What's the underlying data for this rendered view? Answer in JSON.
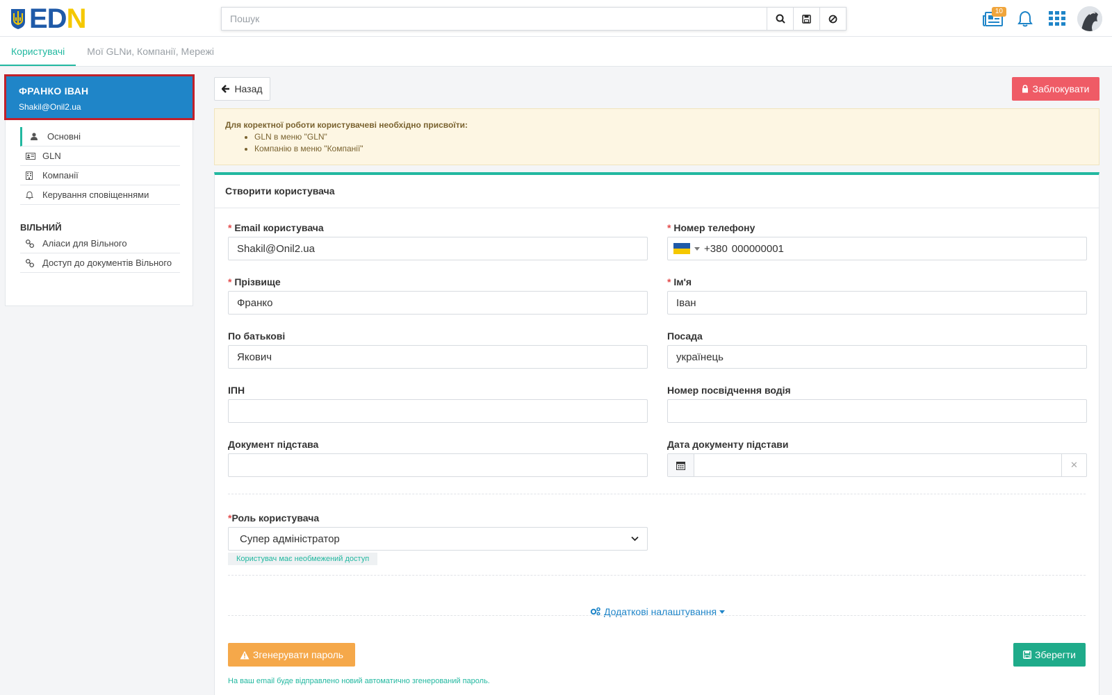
{
  "search": {
    "placeholder": "Пошук"
  },
  "header": {
    "notifications_badge": "10"
  },
  "tabs": [
    {
      "label": "Користувачі",
      "active": true
    },
    {
      "label": "Мої GLNи, Компанії, Мережі",
      "active": false
    }
  ],
  "user_card": {
    "name": "ФРАНКО ІВАН",
    "email": "Shakil@Onil2.ua"
  },
  "sidebar": {
    "items": [
      {
        "label": "Основні",
        "icon": "user-icon",
        "active": true
      },
      {
        "label": "GLN",
        "icon": "id-card-icon"
      },
      {
        "label": "Компанії",
        "icon": "building-icon"
      },
      {
        "label": "Керування сповіщеннями",
        "icon": "bell-icon"
      }
    ],
    "section_title": "ВІЛЬНИЙ",
    "section_items": [
      {
        "label": "Аліаси для Вільного",
        "icon": "link-icon"
      },
      {
        "label": "Доступ до документів Вільного",
        "icon": "link-icon"
      }
    ]
  },
  "actions": {
    "back_label": "Назад",
    "block_label": "Заблокувати"
  },
  "notice": {
    "title": "Для коректної роботи користувачеві необхідно присвоїти:",
    "items": [
      "GLN в меню \"GLN\"",
      "Компанію в меню \"Компанії\""
    ]
  },
  "form": {
    "title": "Створити користувача",
    "email": {
      "label": "Email користувача",
      "value": "Shakil@Onil2.ua"
    },
    "phone": {
      "label": "Номер телефону",
      "code": "+380",
      "value": "000000001"
    },
    "surname": {
      "label": "Прізвище",
      "value": "Франко"
    },
    "first_name": {
      "label": "Ім'я",
      "value": "Іван"
    },
    "patronymic": {
      "label": "По батькові",
      "value": "Якович"
    },
    "position": {
      "label": "Посада",
      "value": "українець"
    },
    "ipn": {
      "label": "ІПН",
      "value": ""
    },
    "driver_license": {
      "label": "Номер посвідчення водія",
      "value": ""
    },
    "basis_doc": {
      "label": "Документ підстава",
      "value": ""
    },
    "basis_date": {
      "label": "Дата документу підстави",
      "value": ""
    },
    "role": {
      "label": "Роль користувача",
      "value": "Супер адміністратор",
      "hint": "Користувач має необмежений доступ"
    },
    "advanced_label": "Додаткові налаштування",
    "generate_label": "Згенерувати пароль",
    "save_label": "Зберегти",
    "generate_note": "На ваш email буде відправлено новий автоматично згенерований пароль."
  },
  "colors": {
    "accent": "#22b8a0",
    "brand_blue": "#1f85c8",
    "danger": "#ef5b66",
    "warning": "#f5a84a",
    "save": "#1fab8a"
  }
}
